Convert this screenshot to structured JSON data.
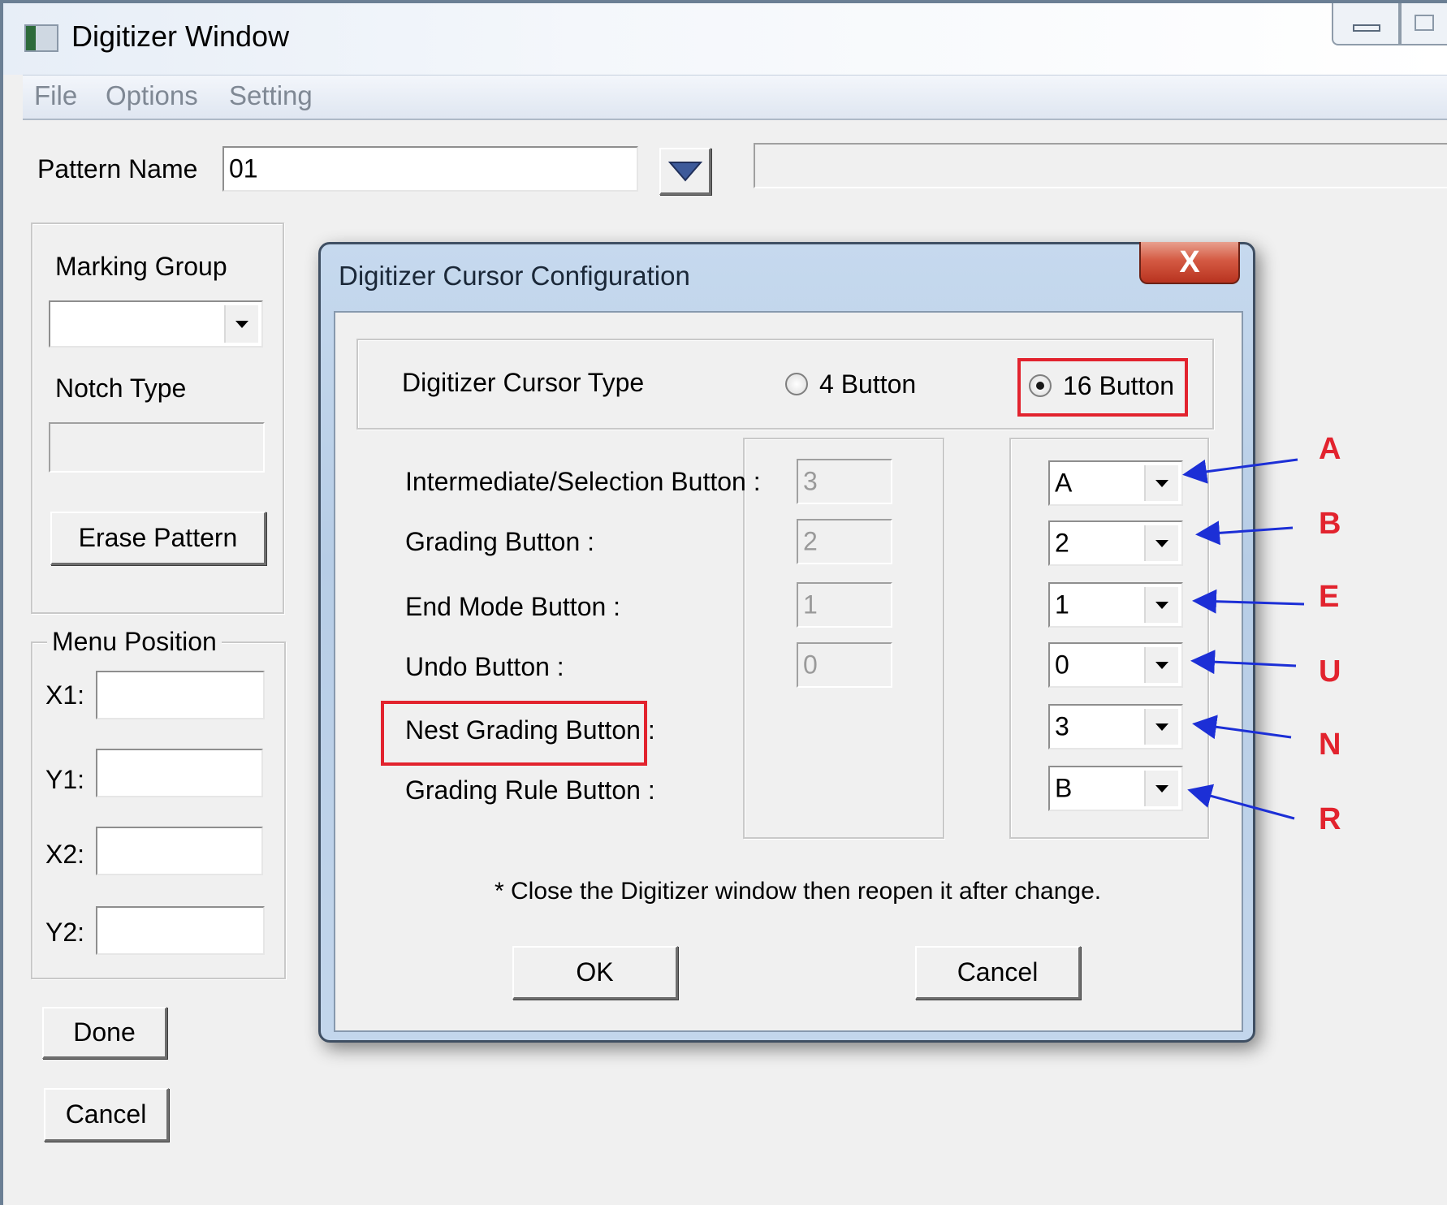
{
  "window": {
    "title": "Digitizer Window",
    "menu": [
      "File",
      "Options",
      "Setting"
    ],
    "pattern_name_label": "Pattern Name",
    "pattern_name_value": "01",
    "marking_group_label": "Marking Group",
    "marking_group_value": "",
    "notch_type_label": "Notch Type",
    "erase_pattern_label": "Erase Pattern",
    "menu_position_label": "Menu Position",
    "coords": [
      {
        "label": "X1:",
        "value": ""
      },
      {
        "label": "Y1:",
        "value": ""
      },
      {
        "label": "X2:",
        "value": ""
      },
      {
        "label": "Y2:",
        "value": ""
      }
    ],
    "done_label": "Done",
    "cancel_label": "Cancel"
  },
  "dialog": {
    "title": "Digitizer Cursor Configuration",
    "close_label": "X",
    "cursor_type_label": "Digitizer Cursor Type",
    "option_4": "4 Button",
    "option_16": "16 Button",
    "selected_option": "16 Button",
    "rows": [
      {
        "label": "Intermediate/Selection Button :",
        "default": "3",
        "value": "A",
        "annotation": "A"
      },
      {
        "label": "Grading Button :",
        "default": "2",
        "value": "2",
        "annotation": "B"
      },
      {
        "label": "End Mode Button :",
        "default": "1",
        "value": "1",
        "annotation": "E"
      },
      {
        "label": "Undo Button :",
        "default": "0",
        "value": "0",
        "annotation": "U"
      },
      {
        "label": "Nest Grading Button :",
        "default": "",
        "value": "3",
        "annotation": "N"
      },
      {
        "label": "Grading Rule Button :",
        "default": "",
        "value": "B",
        "annotation": "R"
      }
    ],
    "note": "* Close the Digitizer window then reopen it after change.",
    "ok_label": "OK",
    "cancel_label": "Cancel"
  },
  "colors": {
    "highlight_box": "#e2232e",
    "arrow": "#1c2fd6",
    "annotation_text": "#e2232e"
  }
}
